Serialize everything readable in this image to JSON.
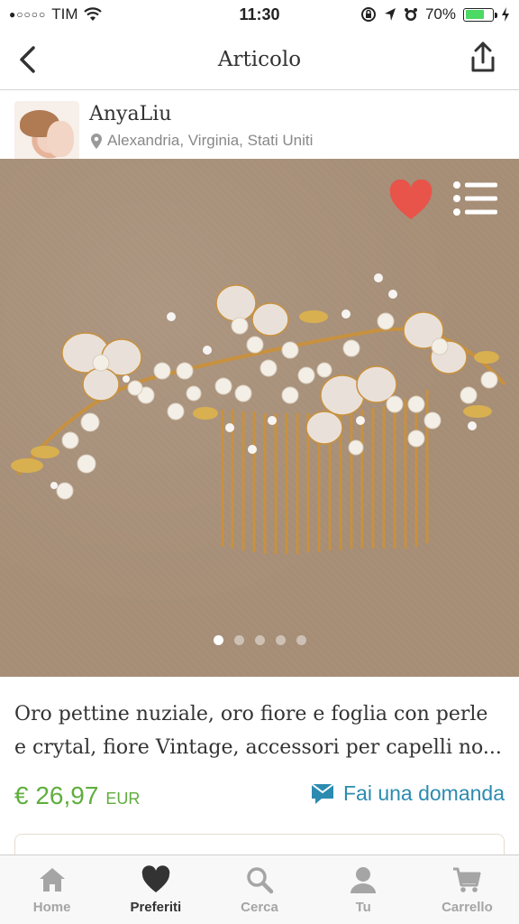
{
  "status": {
    "carrier": "TIM",
    "time": "11:30",
    "battery": "70%",
    "battery_level": 0.7
  },
  "nav": {
    "title": "Articolo",
    "back_icon": "chevron-left-icon",
    "share_icon": "share-icon"
  },
  "seller": {
    "name": "AnyaLiu",
    "location": "Alexandria, Virginia, Stati Uniti"
  },
  "gallery": {
    "image_count": 5,
    "active_index": 0
  },
  "listing": {
    "title": "Oro pettine nuziale, oro fiore e foglia con perle e crytal, fiore Vintage, accessori per capelli no...",
    "price": "€ 26,97",
    "currency": "EUR",
    "ask_label": "Fai una domanda"
  },
  "tabs": [
    {
      "label": "Home",
      "icon": "home-icon",
      "active": false
    },
    {
      "label": "Preferiti",
      "icon": "heart-icon",
      "active": true
    },
    {
      "label": "Cerca",
      "icon": "search-icon",
      "active": false
    },
    {
      "label": "Tu",
      "icon": "user-icon",
      "active": false
    },
    {
      "label": "Carrello",
      "icon": "cart-icon",
      "active": false
    }
  ],
  "colors": {
    "price_green": "#5fae3d",
    "link_blue": "#2c8bb0",
    "favorite_red": "#e8534a",
    "battery_green": "#4cd964"
  }
}
